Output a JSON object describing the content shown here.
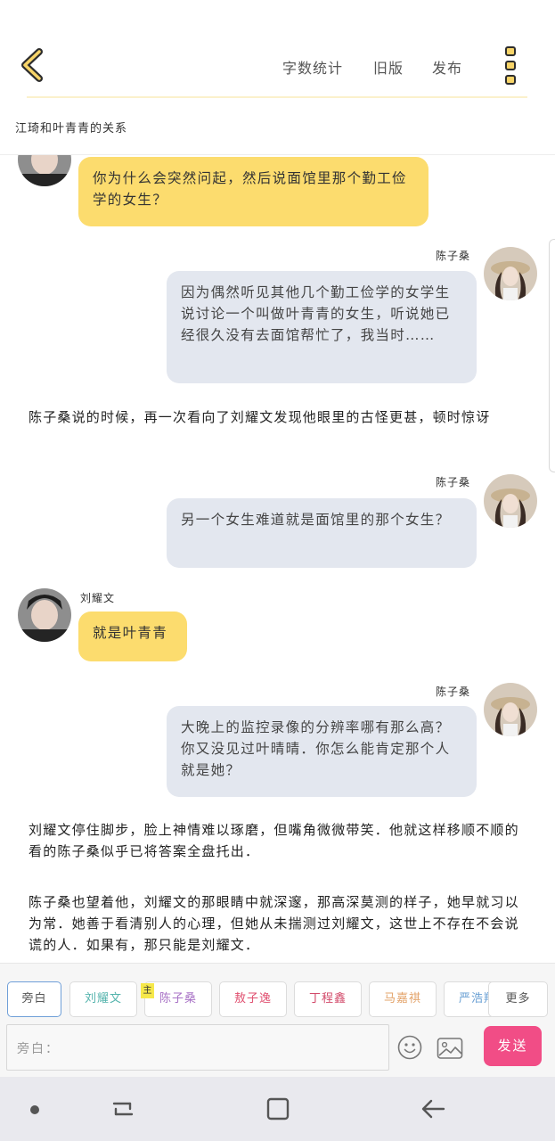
{
  "header": {
    "word_count_label": "字数统计",
    "old_version_label": "旧版",
    "publish_label": "发布"
  },
  "chapter": {
    "title": "江琦和叶青青的关系"
  },
  "messages": {
    "m1": {
      "text": "你为什么会突然问起，然后说面馆里那个勤工俭学的女生？"
    },
    "m2": {
      "speaker": "陈子桑",
      "text": "因为偶然听见其他几个勤工俭学的女学生说讨论一个叫做叶青青的女生，听说她已经很久没有去面馆帮忙了，我当时……"
    },
    "n1": {
      "text": "陈子桑说的时候，再一次看向了刘耀文发现他眼里的古怪更甚，顿时惊讶"
    },
    "m3": {
      "speaker": "陈子桑",
      "text": "另一个女生难道就是面馆里的那个女生？"
    },
    "m4": {
      "speaker": "刘耀文",
      "text": "就是叶青青"
    },
    "m5": {
      "speaker": "陈子桑",
      "text": "大晚上的监控录像的分辨率哪有那么高？你又没见过叶晴晴．你怎么能肯定那个人就是她？"
    },
    "n2": {
      "text": "刘耀文停住脚步，脸上神情难以琢磨，但嘴角微微带笑．他就这样移顺不顺的看的陈子桑似乎已将答案全盘托出．"
    },
    "n3": {
      "text": "陈子桑也望着他，刘耀文的那眼睛中就深邃，那高深莫测的样子，她早就习以为常．她善于看清别人的心理，但她从未揣测过刘耀文，这世上不存在不会说谎的人．如果有，那只能是刘耀文．"
    }
  },
  "roles": {
    "r0": "旁白",
    "r1": "刘耀文",
    "r2": "陈子桑",
    "r3": "敖子逸",
    "r4": "丁程鑫",
    "r5": "马嘉祺",
    "r6": "严浩翔",
    "main_badge": "主",
    "more": "更多"
  },
  "composer": {
    "placeholder": "旁白：",
    "send_label": "发送"
  },
  "colors": {
    "left_bubble": "#fcdc6e",
    "right_bubble": "#e3e7ef",
    "send_button": "#f14d86",
    "active_role_border": "#6f9fd8",
    "role_liu": "#53b3ac",
    "role_chen": "#a973c6",
    "role_ao": "#e05070",
    "role_ding": "#d24a6a",
    "role_ma": "#e3a36a",
    "role_yan": "#6aa0d4"
  }
}
